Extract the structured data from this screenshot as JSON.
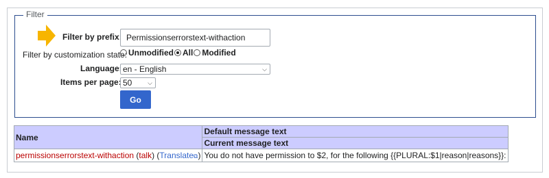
{
  "filter": {
    "legend": "Filter",
    "prefix_label": "Filter by prefix:",
    "prefix_value": "Permissionserrorstext-withaction",
    "state_label": "Filter by customization state:",
    "state_options": [
      "Unmodified",
      "All",
      "Modified"
    ],
    "state_selected": "All",
    "language_label": "Language:",
    "language_value": "en - English",
    "items_label": "Items per page:",
    "items_value": "50",
    "go_label": "Go"
  },
  "table": {
    "col_name": "Name",
    "col_default": "Default message text",
    "col_current": "Current message text",
    "row": {
      "name": "permissionserrorstext-withaction",
      "talk": "talk",
      "translate": "Translate",
      "text": "You do not have permission to $2, for the following {{PLURAL:$1|reason|reasons}}:"
    }
  },
  "colors": {
    "accent": "#3366cc",
    "header_bg": "#ccccff",
    "link_red": "#ba0000",
    "arrow": "#f7b500"
  }
}
